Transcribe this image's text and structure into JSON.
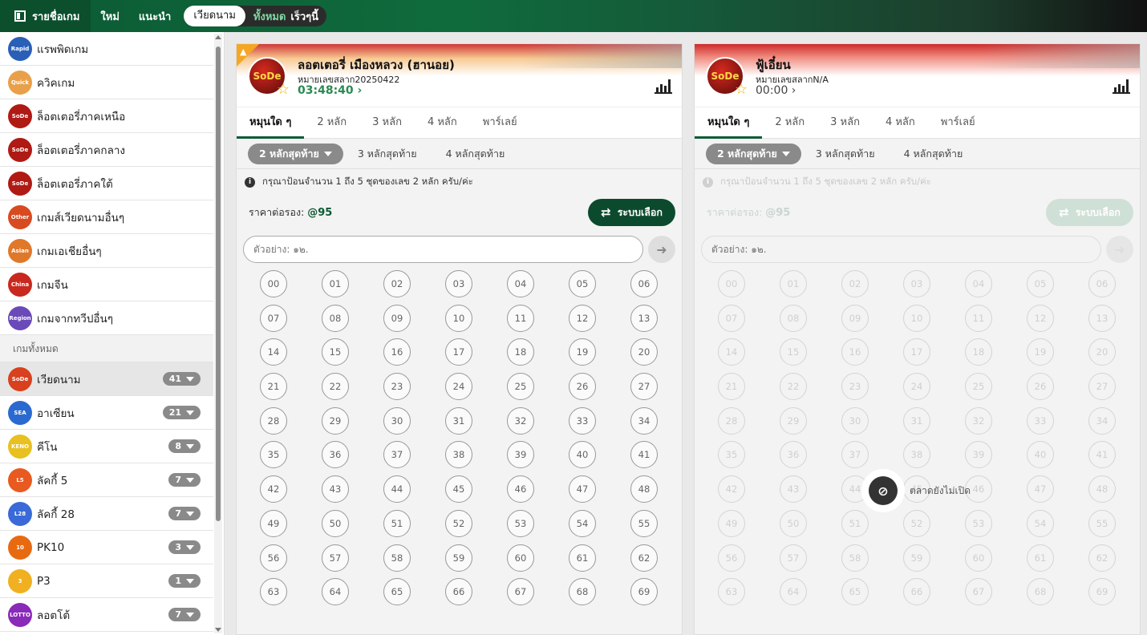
{
  "topbar": {
    "menu_label": "รายชื่อเกม",
    "tabs": [
      "ใหม่",
      "แนะนำ"
    ],
    "pill_active": "เวียดนาม",
    "pill_green": "ทั้งหมด",
    "pill_white": "เร็วๆนี้"
  },
  "sidebar": {
    "items": [
      {
        "label": "แรพพิดเกม",
        "logo": "Rapid",
        "color": "#2a5fb8"
      },
      {
        "label": "ควิคเกม",
        "logo": "Quick",
        "color": "#e8a04a"
      },
      {
        "label": "ล็อตเตอรี่ภาคเหนือ",
        "logo": "SoDe",
        "color": "#b01a14"
      },
      {
        "label": "ล็อตเตอรี่ภาคกลาง",
        "logo": "SoDe",
        "color": "#b01a14"
      },
      {
        "label": "ล็อตเตอรี่ภาคใต้",
        "logo": "SoDe",
        "color": "#b01a14"
      },
      {
        "label": "เกมส์เวียดนามอื่นๆ",
        "logo": "Other",
        "color": "#d84a20"
      },
      {
        "label": "เกมเอเชียอื่นๆ",
        "logo": "Asian",
        "color": "#e0782a"
      },
      {
        "label": "เกมจีน",
        "logo": "China",
        "color": "#c8281e"
      },
      {
        "label": "เกมจากทวีปอื่นๆ",
        "logo": "Region",
        "color": "#6a4ab8"
      }
    ],
    "section_label": "เกมทั้งหมด",
    "groups": [
      {
        "label": "เวียดนาม",
        "count": "41",
        "logo": "SoDe",
        "color": "#d8401e"
      },
      {
        "label": "อาเซียน",
        "count": "21",
        "logo": "SEA",
        "color": "#2a6ad0"
      },
      {
        "label": "คีโน",
        "count": "8",
        "logo": "KENO",
        "color": "#e8c020"
      },
      {
        "label": "ลัคกี้ 5",
        "count": "7",
        "logo": "L5",
        "color": "#e85a20"
      },
      {
        "label": "ลัคกี้ 28",
        "count": "7",
        "logo": "L28",
        "color": "#3a6ad8"
      },
      {
        "label": "PK10",
        "count": "3",
        "logo": "10",
        "color": "#e86a10"
      },
      {
        "label": "P3",
        "count": "1",
        "logo": "3",
        "color": "#f0b020"
      },
      {
        "label": "ลอตโต้",
        "count": "7",
        "logo": "LOTTO",
        "color": "#8a2ab8"
      }
    ]
  },
  "panels": [
    {
      "title": "ลอตเตอรี่ เมืองหลวง (ฮานอย)",
      "draw": "หมายเลขสลาก20250422",
      "time": "03:48:40 ›",
      "logo": "SoDe",
      "tabs": [
        "หมุนใด ๆ",
        "2 หลัก",
        "3 หลัก",
        "4 หลัก",
        "พาร์เลย์"
      ],
      "subtabs": [
        "2 หลักสุดท้าย",
        "3 หลักสุดท้าย",
        "4 หลักสุดท้าย"
      ],
      "info": "กรุณาป้อนจำนวน 1 ถึง 5 ชุดของเลข 2 หลัก ครับ/ค่ะ",
      "price_label": "ราคาต่อรอง:",
      "price_value": "@95",
      "random_label": "ระบบเลือก",
      "input_placeholder": "ตัวอย่าง: ๑๒."
    },
    {
      "title": "ฟู้เอี๋ยน",
      "draw": "หมายเลขสลากN/A",
      "time": "00:00 ›",
      "logo": "SoDe",
      "tabs": [
        "หมุนใด ๆ",
        "2 หลัก",
        "3 หลัก",
        "4 หลัก",
        "พาร์เลย์"
      ],
      "subtabs": [
        "2 หลักสุดท้าย",
        "3 หลักสุดท้าย",
        "4 หลักสุดท้าย"
      ],
      "info": "กรุณาป้อนจำนวน 1 ถึง 5 ชุดของเลข 2 หลัก ครับ/ค่ะ",
      "price_label": "ราคาต่อรอง:",
      "price_value": "@95",
      "random_label": "ระบบเลือก",
      "input_placeholder": "ตัวอย่าง: ๑๒.",
      "closed_text": "ตลาดยังไม่เปิด"
    }
  ],
  "numbers": [
    "00",
    "01",
    "02",
    "03",
    "04",
    "05",
    "06",
    "07",
    "08",
    "09",
    "10",
    "11",
    "12",
    "13",
    "14",
    "15",
    "16",
    "17",
    "18",
    "19",
    "20",
    "21",
    "22",
    "23",
    "24",
    "25",
    "26",
    "27",
    "28",
    "29",
    "30",
    "31",
    "32",
    "33",
    "34",
    "35",
    "36",
    "37",
    "38",
    "39",
    "40",
    "41",
    "42",
    "43",
    "44",
    "45",
    "46",
    "47",
    "48",
    "49",
    "50",
    "51",
    "52",
    "53",
    "54",
    "55",
    "56",
    "57",
    "58",
    "59",
    "60",
    "61",
    "62",
    "63",
    "64",
    "65",
    "66",
    "67",
    "68",
    "69"
  ]
}
